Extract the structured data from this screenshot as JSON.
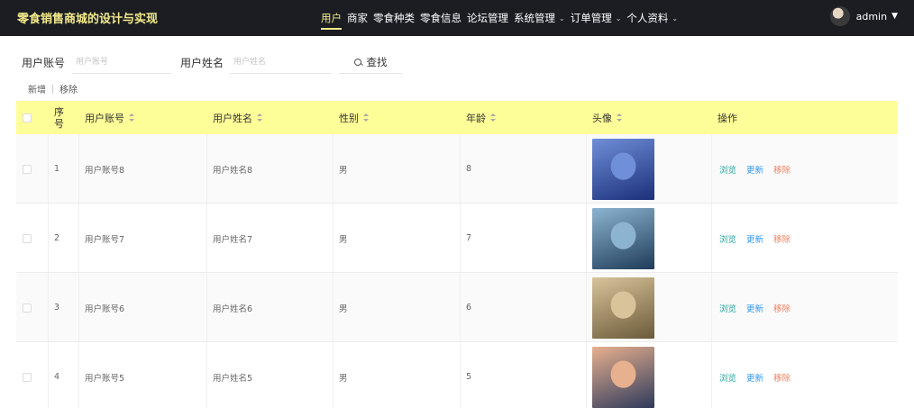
{
  "header": {
    "site_title": "零食销售商城的设计与实现",
    "nav": [
      {
        "label": "用户",
        "active": true,
        "dropdown": false
      },
      {
        "label": "商家",
        "active": false,
        "dropdown": false
      },
      {
        "label": "零食种类",
        "active": false,
        "dropdown": false
      },
      {
        "label": "零食信息",
        "active": false,
        "dropdown": false
      },
      {
        "label": "论坛管理",
        "active": false,
        "dropdown": false
      },
      {
        "label": "系统管理",
        "active": false,
        "dropdown": true
      },
      {
        "label": "订单管理",
        "active": false,
        "dropdown": true
      },
      {
        "label": "个人资料",
        "active": false,
        "dropdown": true
      }
    ],
    "user_name": "admin"
  },
  "search": {
    "account_label": "用户账号",
    "account_placeholder": "用户账号",
    "name_label": "用户姓名",
    "name_placeholder": "用户姓名",
    "search_button": "查找"
  },
  "actions": {
    "add": "新增",
    "remove": "移除"
  },
  "table": {
    "columns": [
      "序号",
      "用户账号",
      "用户姓名",
      "性别",
      "年龄",
      "头像",
      "操作"
    ],
    "rows": [
      {
        "index": "1",
        "account": "用户账号8",
        "name": "用户姓名8",
        "gender": "男",
        "age": "8",
        "avatar_colors": [
          "#1c2f7a",
          "#6f8fd8"
        ]
      },
      {
        "index": "2",
        "account": "用户账号7",
        "name": "用户姓名7",
        "gender": "男",
        "age": "7",
        "avatar_colors": [
          "#1f3c5a",
          "#8cb4d0"
        ]
      },
      {
        "index": "3",
        "account": "用户账号6",
        "name": "用户姓名6",
        "gender": "男",
        "age": "6",
        "avatar_colors": [
          "#6b5a3a",
          "#d8c49a"
        ]
      },
      {
        "index": "4",
        "account": "用户账号5",
        "name": "用户姓名5",
        "gender": "男",
        "age": "5",
        "avatar_colors": [
          "#2e3a5c",
          "#e7b08e"
        ]
      }
    ],
    "row_actions": {
      "view": "浏览",
      "edit": "更新",
      "delete": "移除"
    }
  },
  "colors": {
    "nav_bg": "#1b1d22",
    "accent_yellow": "#f3ea8a",
    "table_header_bg": "#fefe99",
    "view_color": "#2aa8a0",
    "edit_color": "#3399ee",
    "delete_color": "#ef8161"
  }
}
